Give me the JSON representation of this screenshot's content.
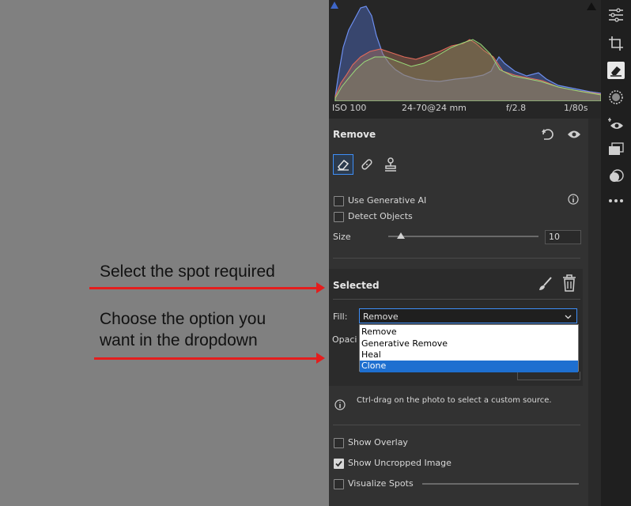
{
  "annotations": {
    "step1": "Select the spot required",
    "step2_line1": "Choose the option you",
    "step2_line2": "want in the dropdown"
  },
  "histogram": {
    "iso": "ISO 100",
    "lens": "24-70@24 mm",
    "aperture": "f/2.8",
    "shutter": "1/80s"
  },
  "remove_panel": {
    "title": "Remove",
    "use_generative_ai": "Use Generative AI",
    "detect_objects": "Detect Objects",
    "size_label": "Size",
    "size_value": "10",
    "size_fraction": 0.05
  },
  "selected_panel": {
    "title": "Selected",
    "fill_label": "Fill:",
    "fill_value": "Remove",
    "opacity_label_partial": "Opaci",
    "fill_options": [
      "Remove",
      "Generative Remove",
      "Heal",
      "Clone"
    ],
    "highlighted_option": "Clone",
    "hint": "Ctrl-drag on the photo to select a custom source."
  },
  "options": {
    "show_overlay": "Show Overlay",
    "show_overlay_checked": false,
    "show_uncropped": "Show Uncropped Image",
    "show_uncropped_checked": true,
    "visualize_spots": "Visualize Spots",
    "visualize_spots_checked": false
  },
  "colors": {
    "accent": "#3e8ef7",
    "arrow": "#e41d1d",
    "highlight": "#1e6fd0"
  },
  "rail_icons": [
    "sliders-icon",
    "crop-icon",
    "eraser-icon",
    "masking-icon",
    "redeye-icon",
    "presets-icon",
    "versions-icon",
    "more-icon"
  ]
}
